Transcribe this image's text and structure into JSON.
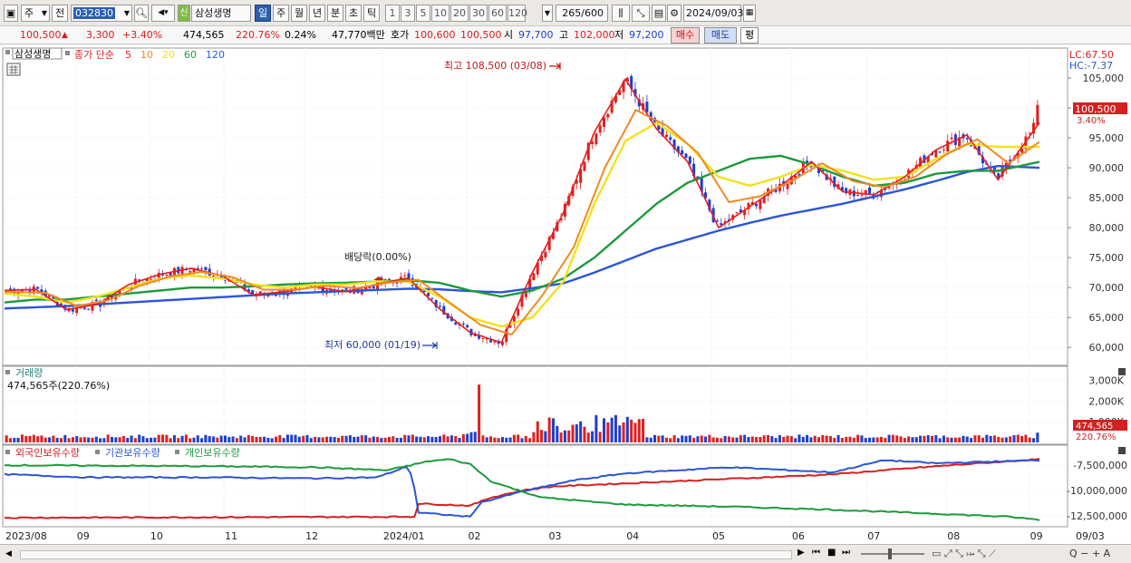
{
  "toolbar": {
    "market": "주",
    "board": "전",
    "code": "032830",
    "new_badge": "신",
    "stock_name": "삼성생명",
    "periods": [
      "일",
      "주",
      "월",
      "년",
      "분",
      "초",
      "틱"
    ],
    "active_period": "일",
    "minutes": [
      "1",
      "3",
      "5",
      "10",
      "20",
      "30",
      "60",
      "120"
    ],
    "count": "265",
    "count_total": "/600",
    "date": "2024/09/03"
  },
  "quote": {
    "price": "100,500",
    "arrow": "▲",
    "change": "3,300",
    "change_pct": "+3.40%",
    "volume": "474,565",
    "volume_ratio": "220.76%",
    "turnover": "0.24%",
    "amount": "47,770백만",
    "ask_label": "호가",
    "ask": "100,600",
    "bid": "100,500",
    "open_label": "시",
    "open": "97,700",
    "high_label": "고",
    "high": "102,000",
    "low_label": "저",
    "low": "97,200",
    "buy": "매수",
    "sell": "매도",
    "eval": "평"
  },
  "price_panel": {
    "name": "삼성생명",
    "ma_label": "종가 단순",
    "ma_periods": [
      {
        "label": "5",
        "color": "#e41f1f"
      },
      {
        "label": "10",
        "color": "#f08a24"
      },
      {
        "label": "20",
        "color": "#f2e21a"
      },
      {
        "label": "60",
        "color": "#1e9a3c"
      },
      {
        "label": "120",
        "color": "#2b55d8"
      }
    ],
    "lc": "LC:67.50",
    "hc": "HC:-7.37",
    "high_note": "최고 108,500 (03/08)",
    "low_note": "최저 60,000 (01/19)",
    "dividend_note": "배당락(0.00%)",
    "last_price_tag": "100,500",
    "last_pct_tag": "3.40%"
  },
  "volume_panel": {
    "title": "거래량",
    "info": "474,565주(220.76%)",
    "tag": "474,565",
    "tag2": "220.76%"
  },
  "holding_panel": {
    "legend": [
      {
        "label": "외국인보유수량",
        "color": "#d42020"
      },
      {
        "label": "기관보유수량",
        "color": "#2b55d8"
      },
      {
        "label": "개인보유수량",
        "color": "#1e9a3c"
      }
    ]
  },
  "chart_data": [
    {
      "type": "candlestick",
      "title": "삼성생명",
      "ylim": [
        57000,
        110000
      ],
      "y_ticks": [
        "105,000",
        "100,000",
        "95,000",
        "90,000",
        "85,000",
        "80,000",
        "75,000",
        "70,000",
        "65,000",
        "60,000"
      ],
      "y_values": [
        105000,
        100000,
        95000,
        90000,
        85000,
        80000,
        75000,
        70000,
        65000,
        60000
      ],
      "ma_knots": {
        "x": [
          0,
          0.03,
          0.06,
          0.09,
          0.12,
          0.15,
          0.18,
          0.21,
          0.24,
          0.27,
          0.3,
          0.33,
          0.36,
          0.39,
          0.42,
          0.45,
          0.48,
          0.51,
          0.54,
          0.57,
          0.6,
          0.63,
          0.66,
          0.69,
          0.72,
          0.75,
          0.78,
          0.81,
          0.84,
          0.87,
          0.9,
          0.93,
          0.96,
          1.0
        ],
        "ma5": [
          69500,
          69700,
          66300,
          67200,
          70500,
          72200,
          73200,
          72000,
          68800,
          69300,
          70100,
          69300,
          70600,
          71600,
          66500,
          62500,
          60800,
          72500,
          82500,
          96000,
          104800,
          96500,
          91000,
          80000,
          83500,
          87000,
          91000,
          86000,
          85500,
          88500,
          93000,
          95500,
          88000,
          97500
        ],
        "ma20": [
          69000,
          68500,
          67500,
          68500,
          70000,
          71500,
          72000,
          71500,
          70500,
          70000,
          70500,
          70500,
          71000,
          71000,
          68500,
          65000,
          63500,
          65000,
          71000,
          84000,
          94500,
          97500,
          94000,
          88500,
          87000,
          88500,
          90500,
          89500,
          88000,
          88500,
          91500,
          94000,
          93500,
          93500
        ],
        "ma60": [
          67500,
          68000,
          68000,
          68500,
          69000,
          69500,
          70000,
          70000,
          70200,
          70500,
          70700,
          70800,
          71000,
          71200,
          70800,
          69500,
          68500,
          69500,
          71500,
          75000,
          79500,
          84000,
          87500,
          89500,
          91500,
          92000,
          90500,
          88500,
          87000,
          87500,
          89000,
          89500,
          89500,
          91000
        ],
        "ma120": [
          66500,
          66700,
          66900,
          67200,
          67500,
          67800,
          68100,
          68400,
          68700,
          69000,
          69200,
          69400,
          69600,
          69800,
          69700,
          69400,
          69200,
          69900,
          70700,
          72500,
          74500,
          76500,
          78000,
          79500,
          80800,
          82000,
          83000,
          84000,
          85200,
          86400,
          87800,
          89300,
          90300,
          90000
        ]
      },
      "annotations": [
        "최고 108,500 (03/08)",
        "최저 60,000 (01/19)",
        "배당락(0.00%)"
      ]
    },
    {
      "type": "bar",
      "title": "거래량",
      "y_ticks": [
        "3,000K",
        "2,000K",
        "1,000K"
      ],
      "y_values": [
        3000000,
        2000000,
        1000000
      ],
      "ylim": [
        0,
        3600000
      ],
      "last_value": 474565
    },
    {
      "type": "line",
      "series_names": [
        "외국인보유수량",
        "기관보유수량",
        "개인보유수량"
      ],
      "y_ticks": [
        "-7,500,000",
        "-10,000,000",
        "-12,500,000"
      ],
      "y_values": [
        -7500000,
        -10000000,
        -12500000
      ],
      "ylim": [
        -13500000,
        -5600000
      ]
    }
  ],
  "x_axis": [
    "2023/08",
    "09",
    "10",
    "11",
    "12",
    "2024/01",
    "02",
    "03",
    "04",
    "05",
    "06",
    "07",
    "08",
    "09",
    "09/03"
  ]
}
